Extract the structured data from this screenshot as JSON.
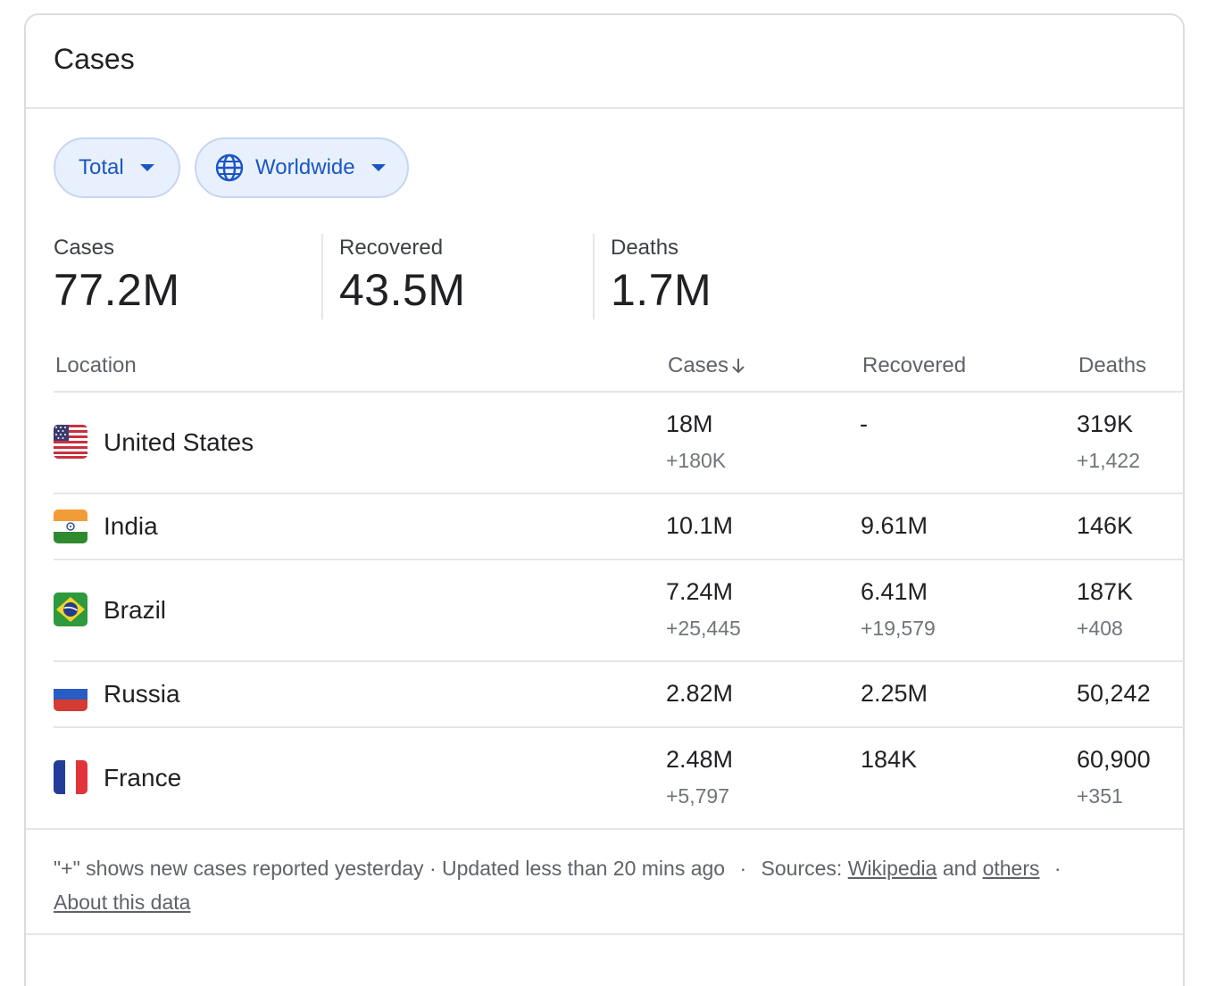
{
  "header": {
    "title": "Cases"
  },
  "filters": {
    "metric": {
      "label": "Total",
      "icon": "caret-down-icon"
    },
    "region": {
      "label": "Worldwide",
      "icon": "globe-icon"
    }
  },
  "summary": [
    {
      "label": "Cases",
      "value": "77.2M"
    },
    {
      "label": "Recovered",
      "value": "43.5M"
    },
    {
      "label": "Deaths",
      "value": "1.7M"
    }
  ],
  "table": {
    "headers": {
      "location": "Location",
      "cases": "Cases",
      "recovered": "Recovered",
      "deaths": "Deaths"
    },
    "sort_icon": "arrow-down-icon",
    "rows": [
      {
        "country": "United States",
        "flag": "us-flag-icon",
        "cases": "18M",
        "cases_delta": "+180K",
        "recovered": "-",
        "recovered_delta": "",
        "deaths": "319K",
        "deaths_delta": "+1,422"
      },
      {
        "country": "India",
        "flag": "india-flag-icon",
        "cases": "10.1M",
        "cases_delta": "",
        "recovered": "9.61M",
        "recovered_delta": "",
        "deaths": "146K",
        "deaths_delta": ""
      },
      {
        "country": "Brazil",
        "flag": "brazil-flag-icon",
        "cases": "7.24M",
        "cases_delta": "+25,445",
        "recovered": "6.41M",
        "recovered_delta": "+19,579",
        "deaths": "187K",
        "deaths_delta": "+408"
      },
      {
        "country": "Russia",
        "flag": "russia-flag-icon",
        "cases": "2.82M",
        "cases_delta": "",
        "recovered": "2.25M",
        "recovered_delta": "",
        "deaths": "50,242",
        "deaths_delta": ""
      },
      {
        "country": "France",
        "flag": "france-flag-icon",
        "cases": "2.48M",
        "cases_delta": "+5,797",
        "recovered": "184K",
        "recovered_delta": "",
        "deaths": "60,900",
        "deaths_delta": "+351"
      }
    ]
  },
  "footer": {
    "note": "\"+\" shows new cases reported yesterday · Updated less than 20 mins ago",
    "sep": "·",
    "sources_label": "Sources:",
    "source_link": "Wikipedia",
    "and_text": "and",
    "others_link": "others",
    "about_link": "About this data"
  },
  "colors": {
    "chip_bg": "#e9f0fd",
    "chip_text": "#1a56c4",
    "divider": "#e5e6e8"
  }
}
